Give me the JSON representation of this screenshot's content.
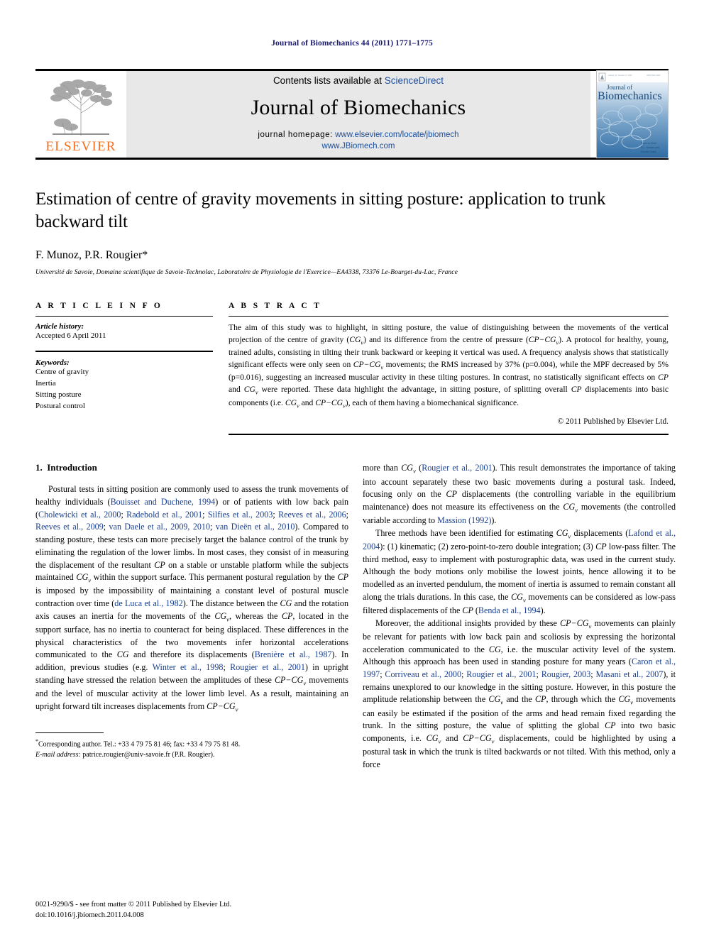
{
  "running_head": "Journal of Biomechanics 44 (2011) 1771–1775",
  "masthead": {
    "contents_prefix": "Contents lists available at ",
    "sciencedirect": "ScienceDirect",
    "journal_title": "Journal of Biomechanics",
    "homepage_label": "journal homepage:",
    "homepage_url": "www.elsevier.com/locate/jbiomech",
    "homepage_url2": "www.JBiomech.com",
    "publisher_wordmark": "ELSEVIER",
    "publisher_color": "#F36F21",
    "link_color": "#1a4fa0",
    "cover": {
      "journal_line1": "Journal of",
      "journal_line2": "Biomechanics",
      "volume_line": "Volume 44 / Number 9 / 2011",
      "issn_line": "ISSN 0021-9290",
      "editor_line1": "Editor-in-Chief",
      "editor_line2": "R.L. Huiskes and",
      "editor_line3": "Farshid Guilak"
    }
  },
  "article": {
    "title": "Estimation of centre of gravity movements in sitting posture: application to trunk backward tilt",
    "authors": "F. Munoz, P.R. Rougier*",
    "affiliation": "Université de Savoie, Domaine scientifique de Savoie-Technolac, Laboratoire de Physiologie de l'Exercice—EA4338, 73376 Le-Bourget-du-Lac, France"
  },
  "article_info": {
    "heading": "A R T I C L E   I N F O",
    "history_label": "Article history:",
    "history_value": "Accepted 6 April 2011",
    "keywords_label": "Keywords:",
    "keywords": [
      "Centre of gravity",
      "Inertia",
      "Sitting posture",
      "Postural control"
    ]
  },
  "abstract": {
    "heading": "A B S T R A C T",
    "text_parts": [
      "The aim of this study was to highlight, in sitting posture, the value of distinguishing between the movements of the vertical projection of the centre of gravity (",
      "CG",
      "v",
      ") and its difference from the centre of pressure (",
      "CP−CG",
      "v",
      "). A protocol for healthy, young, trained adults, consisting in tilting their trunk backward or keeping it vertical was used. A frequency analysis shows that statistically significant effects were only seen on ",
      "CP−CG",
      "v",
      " movements; the RMS increased by 37% (p=0.004), while the MPF decreased by 5% (p=0.016), suggesting an increased muscular activity in these tilting postures. In contrast, no statistically significant effects on ",
      "CP",
      " and ",
      "CG",
      "v",
      " were reported. These data highlight the advantage, in sitting posture, of splitting overall ",
      "CP",
      " displacements into basic components (i.e. ",
      "CG",
      "v",
      " and ",
      "CP−CG",
      "v",
      "), each of them having a biomechanical significance."
    ],
    "copyright": "© 2011 Published by Elsevier Ltd."
  },
  "intro": {
    "section_number": "1.",
    "section_title": "Introduction"
  },
  "footnote": {
    "corresponding": "Corresponding author. Tel.: +33 4 79 75 81 46; fax: +33 4 79 75 81 48.",
    "email_label": "E-mail address:",
    "email": "patrice.rougier@univ-savoie.fr (P.R. Rougier)."
  },
  "page_footer": {
    "line1": "0021-9290/$ - see front matter © 2011 Published by Elsevier Ltd.",
    "line2": "doi:10.1016/j.jbiomech.2011.04.008"
  }
}
